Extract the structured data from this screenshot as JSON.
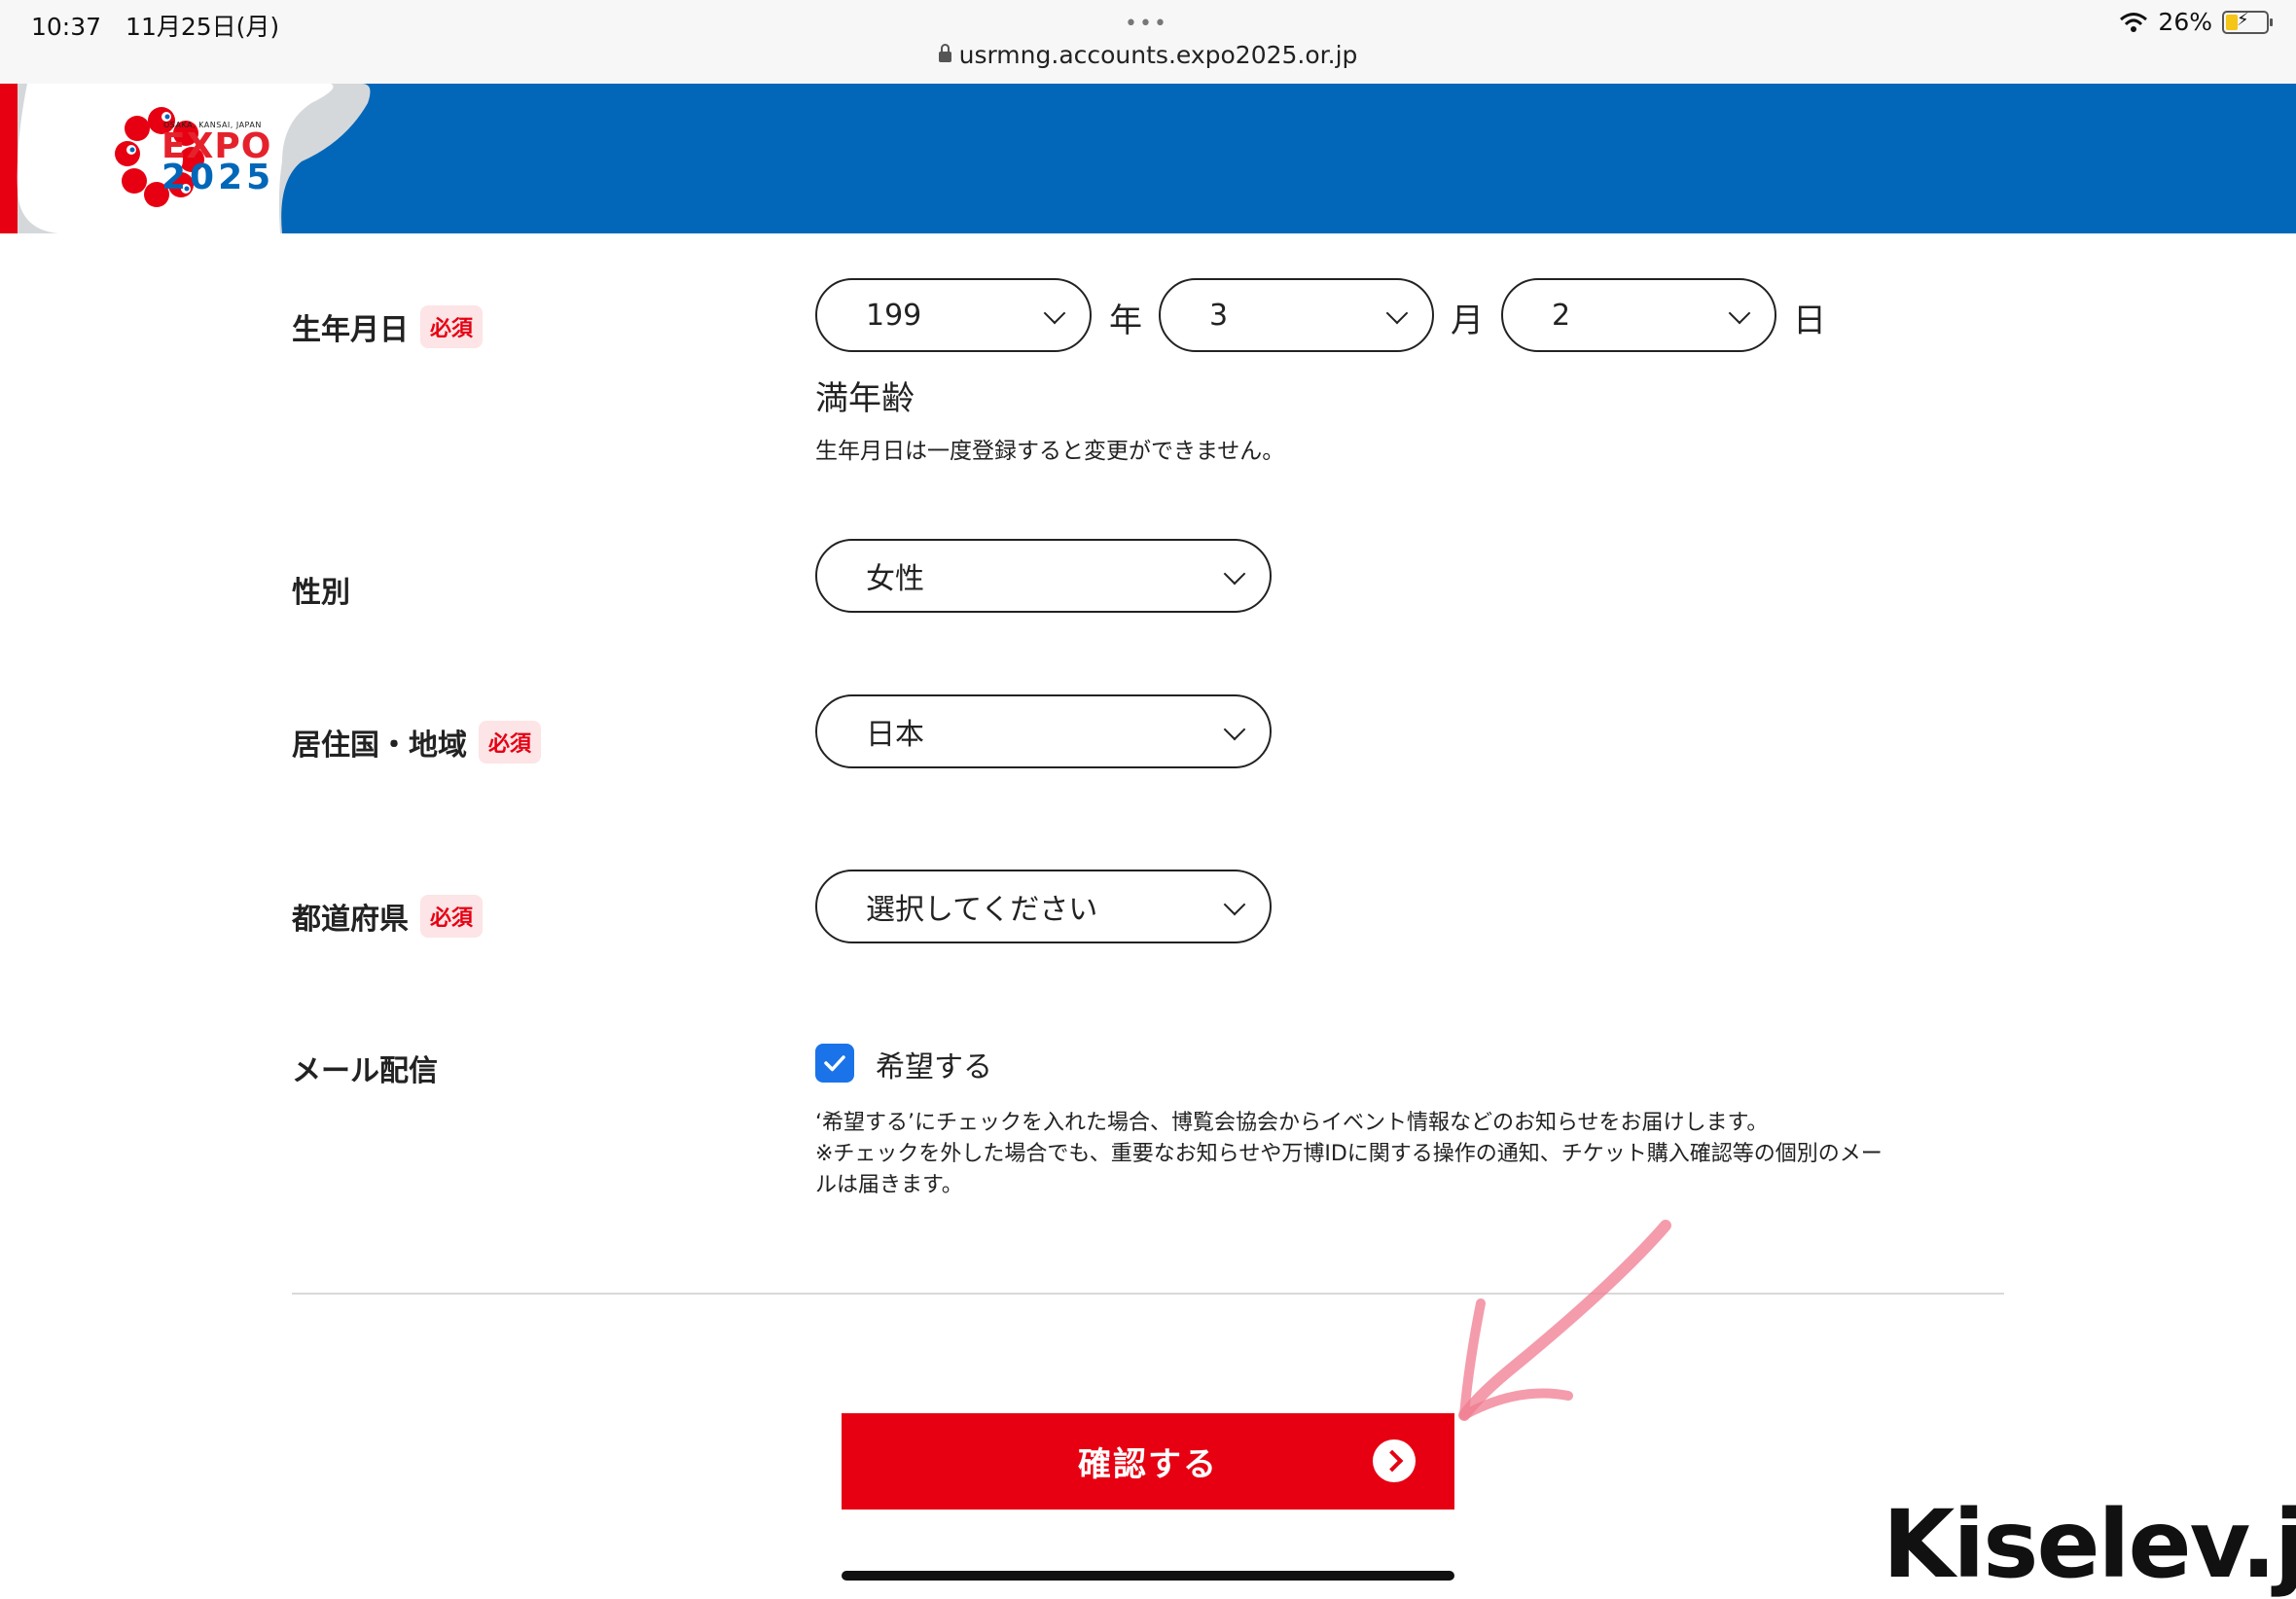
{
  "status_bar": {
    "time_date": "10:37　11月25日(月)",
    "dots": "•••",
    "url": "usrmng.accounts.expo2025.or.jp",
    "battery": "26%"
  },
  "header": {
    "logo_small": "OSAKA, KANSAI, JAPAN",
    "logo_expo": "EXPO",
    "logo_year": "2025"
  },
  "form": {
    "required_badge": "必須",
    "birthdate": {
      "label": "生年月日",
      "year": "199",
      "year_unit": "年",
      "month": "3",
      "month_unit": "月",
      "day": "2",
      "day_unit": "日",
      "age_label": "満年齢",
      "note": "生年月日は一度登録すると変更ができません。"
    },
    "gender": {
      "label": "性別",
      "value": "女性"
    },
    "country": {
      "label": "居住国・地域",
      "value": "日本"
    },
    "prefecture": {
      "label": "都道府県",
      "placeholder": "選択してください"
    },
    "mail": {
      "label": "メール配信",
      "checkbox_label": "希望する",
      "checked": true,
      "note_line1": "‘希望する’にチェックを入れた場合、博覧会協会からイベント情報などのお知らせをお届けします。",
      "note_line2": "※チェックを外した場合でも、重要なお知らせや万博IDに関する操作の通知、チケット購入確認等の個別のメー",
      "note_line3": "ルは届きます。"
    }
  },
  "confirm_button": "確認する",
  "watermark": "Kiselev.jp",
  "colors": {
    "brand_blue": "#0267b8",
    "brand_red": "#e60012",
    "check_blue": "#1a73e8"
  }
}
